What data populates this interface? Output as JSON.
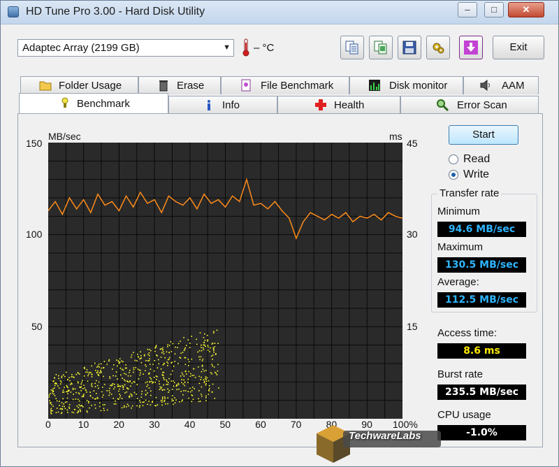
{
  "window": {
    "title": "HD Tune Pro 3.00 - Hard Disk Utility",
    "controls": {
      "minimize": "–",
      "maximize": "□",
      "close": "✕"
    }
  },
  "toolbar": {
    "drive": "Adaptec Array (2199 GB)",
    "temperature": "– °C",
    "icons": [
      "copy-text-icon",
      "copy-screenshot-icon",
      "save-icon",
      "options-icon",
      "save-screenshot-icon"
    ],
    "exit_label": "Exit"
  },
  "tabs": {
    "row1": [
      {
        "label": "Folder Usage",
        "icon": "folder-icon"
      },
      {
        "label": "Erase",
        "icon": "trash-icon"
      },
      {
        "label": "File Benchmark",
        "icon": "file-benchmark-icon"
      },
      {
        "label": "Disk monitor",
        "icon": "disk-monitor-icon"
      },
      {
        "label": "AAM",
        "icon": "speaker-icon"
      }
    ],
    "row2": [
      {
        "label": "Benchmark",
        "icon": "benchmark-icon",
        "active": true
      },
      {
        "label": "Info",
        "icon": "info-icon"
      },
      {
        "label": "Health",
        "icon": "health-cross-icon"
      },
      {
        "label": "Error Scan",
        "icon": "magnifier-icon"
      }
    ]
  },
  "chart_data": {
    "type": "line",
    "y_left_label": "MB/sec",
    "y_right_label": "ms",
    "y_left_ticks": [
      "150",
      "100",
      "50"
    ],
    "y_right_ticks": [
      "45",
      "30",
      "15"
    ],
    "x_ticks": [
      "0",
      "10",
      "20",
      "30",
      "40",
      "50",
      "60",
      "70",
      "80",
      "90",
      "100%"
    ],
    "xlim": [
      0,
      100
    ],
    "ylim_left": [
      0,
      150
    ],
    "ylim_right": [
      0,
      45
    ],
    "grid": true,
    "colors": {
      "background": "#2b2b2b",
      "grid": "#000000",
      "transfer": "#ff8c1a",
      "access": "#ffff33"
    },
    "series": [
      {
        "type": "line",
        "x": [
          0,
          2,
          4,
          6,
          8,
          10,
          12,
          14,
          16,
          18,
          20,
          22,
          24,
          26,
          28,
          30,
          32,
          34,
          36,
          38,
          40,
          42,
          44,
          46,
          48,
          50,
          52,
          54,
          56,
          58,
          60,
          62,
          64,
          66,
          68,
          70,
          72,
          74,
          76,
          78,
          80,
          82,
          84,
          86,
          88,
          90,
          92,
          94,
          96,
          98,
          100
        ],
        "values": [
          113,
          118,
          111,
          120,
          114,
          119,
          112,
          122,
          116,
          118,
          113,
          121,
          115,
          123,
          117,
          119,
          112,
          121,
          118,
          116,
          120,
          114,
          122,
          117,
          119,
          115,
          121,
          118,
          130,
          116,
          117,
          114,
          118,
          113,
          109,
          98,
          107,
          112,
          110,
          108,
          111,
          109,
          112,
          107,
          110,
          109,
          111,
          108,
          112,
          110,
          109
        ]
      },
      {
        "type": "scatter",
        "x_range": [
          0,
          48
        ],
        "y_range_ms": [
          1,
          15
        ],
        "note_values": "access-time samples between 1 ms and 15 ms over 0–48%"
      }
    ]
  },
  "controls": {
    "start_label": "Start",
    "read_label": "Read",
    "write_label": "Write",
    "selected_mode": "Write"
  },
  "stats": {
    "transfer_rate_title": "Transfer rate",
    "minimum_label": "Minimum",
    "minimum_value": "94.6 MB/sec",
    "maximum_label": "Maximum",
    "maximum_value": "130.5 MB/sec",
    "average_label": "Average:",
    "average_value": "112.5 MB/sec",
    "access_time_label": "Access time:",
    "access_time_value": "8.6 ms",
    "burst_rate_label": "Burst rate",
    "burst_rate_value": "235.5 MB/sec",
    "cpu_usage_label": "CPU usage",
    "cpu_usage_value": "-1.0%"
  },
  "watermark": {
    "text": "TechwareLabs"
  }
}
